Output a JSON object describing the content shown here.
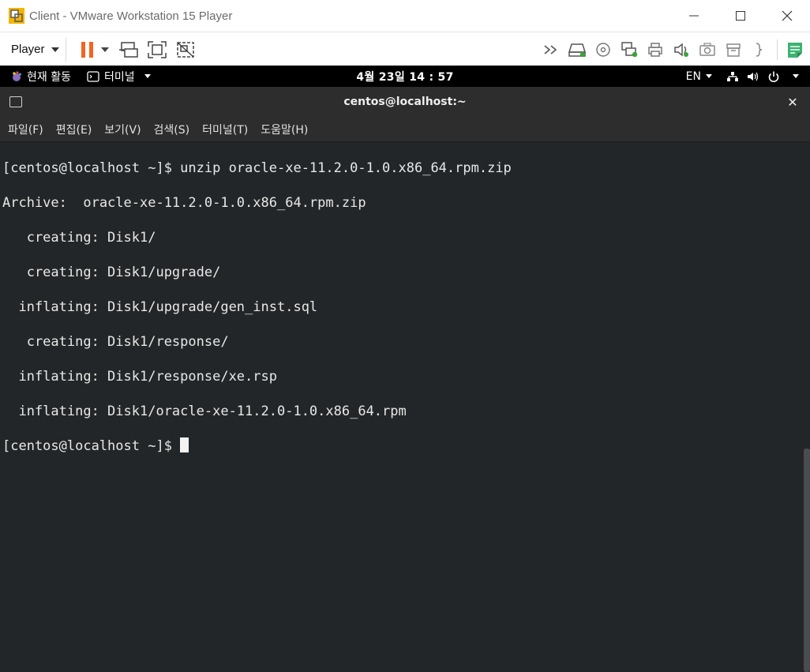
{
  "vmware": {
    "title": "Client - VMware Workstation 15 Player",
    "player_menu": "Player"
  },
  "gnome": {
    "activities": "현재 활동",
    "app_menu": "터미널",
    "clock": "4월 23일  14 : 57",
    "lang": "EN"
  },
  "terminal": {
    "title": "centos@localhost:~",
    "menu": [
      "파일(F)",
      "편집(E)",
      "보기(V)",
      "검색(S)",
      "터미널(T)",
      "도움말(H)"
    ],
    "lines": [
      "[centos@localhost ~]$ unzip oracle-xe-11.2.0-1.0.x86_64.rpm.zip",
      "Archive:  oracle-xe-11.2.0-1.0.x86_64.rpm.zip",
      "   creating: Disk1/",
      "   creating: Disk1/upgrade/",
      "  inflating: Disk1/upgrade/gen_inst.sql",
      "   creating: Disk1/response/",
      "  inflating: Disk1/response/xe.rsp",
      "  inflating: Disk1/oracle-xe-11.2.0-1.0.x86_64.rpm"
    ],
    "prompt": "[centos@localhost ~]$ "
  },
  "colors": {
    "terminal_bg": "#232628",
    "pause_orange": "#f26522",
    "notes_green": "#3cb371"
  }
}
